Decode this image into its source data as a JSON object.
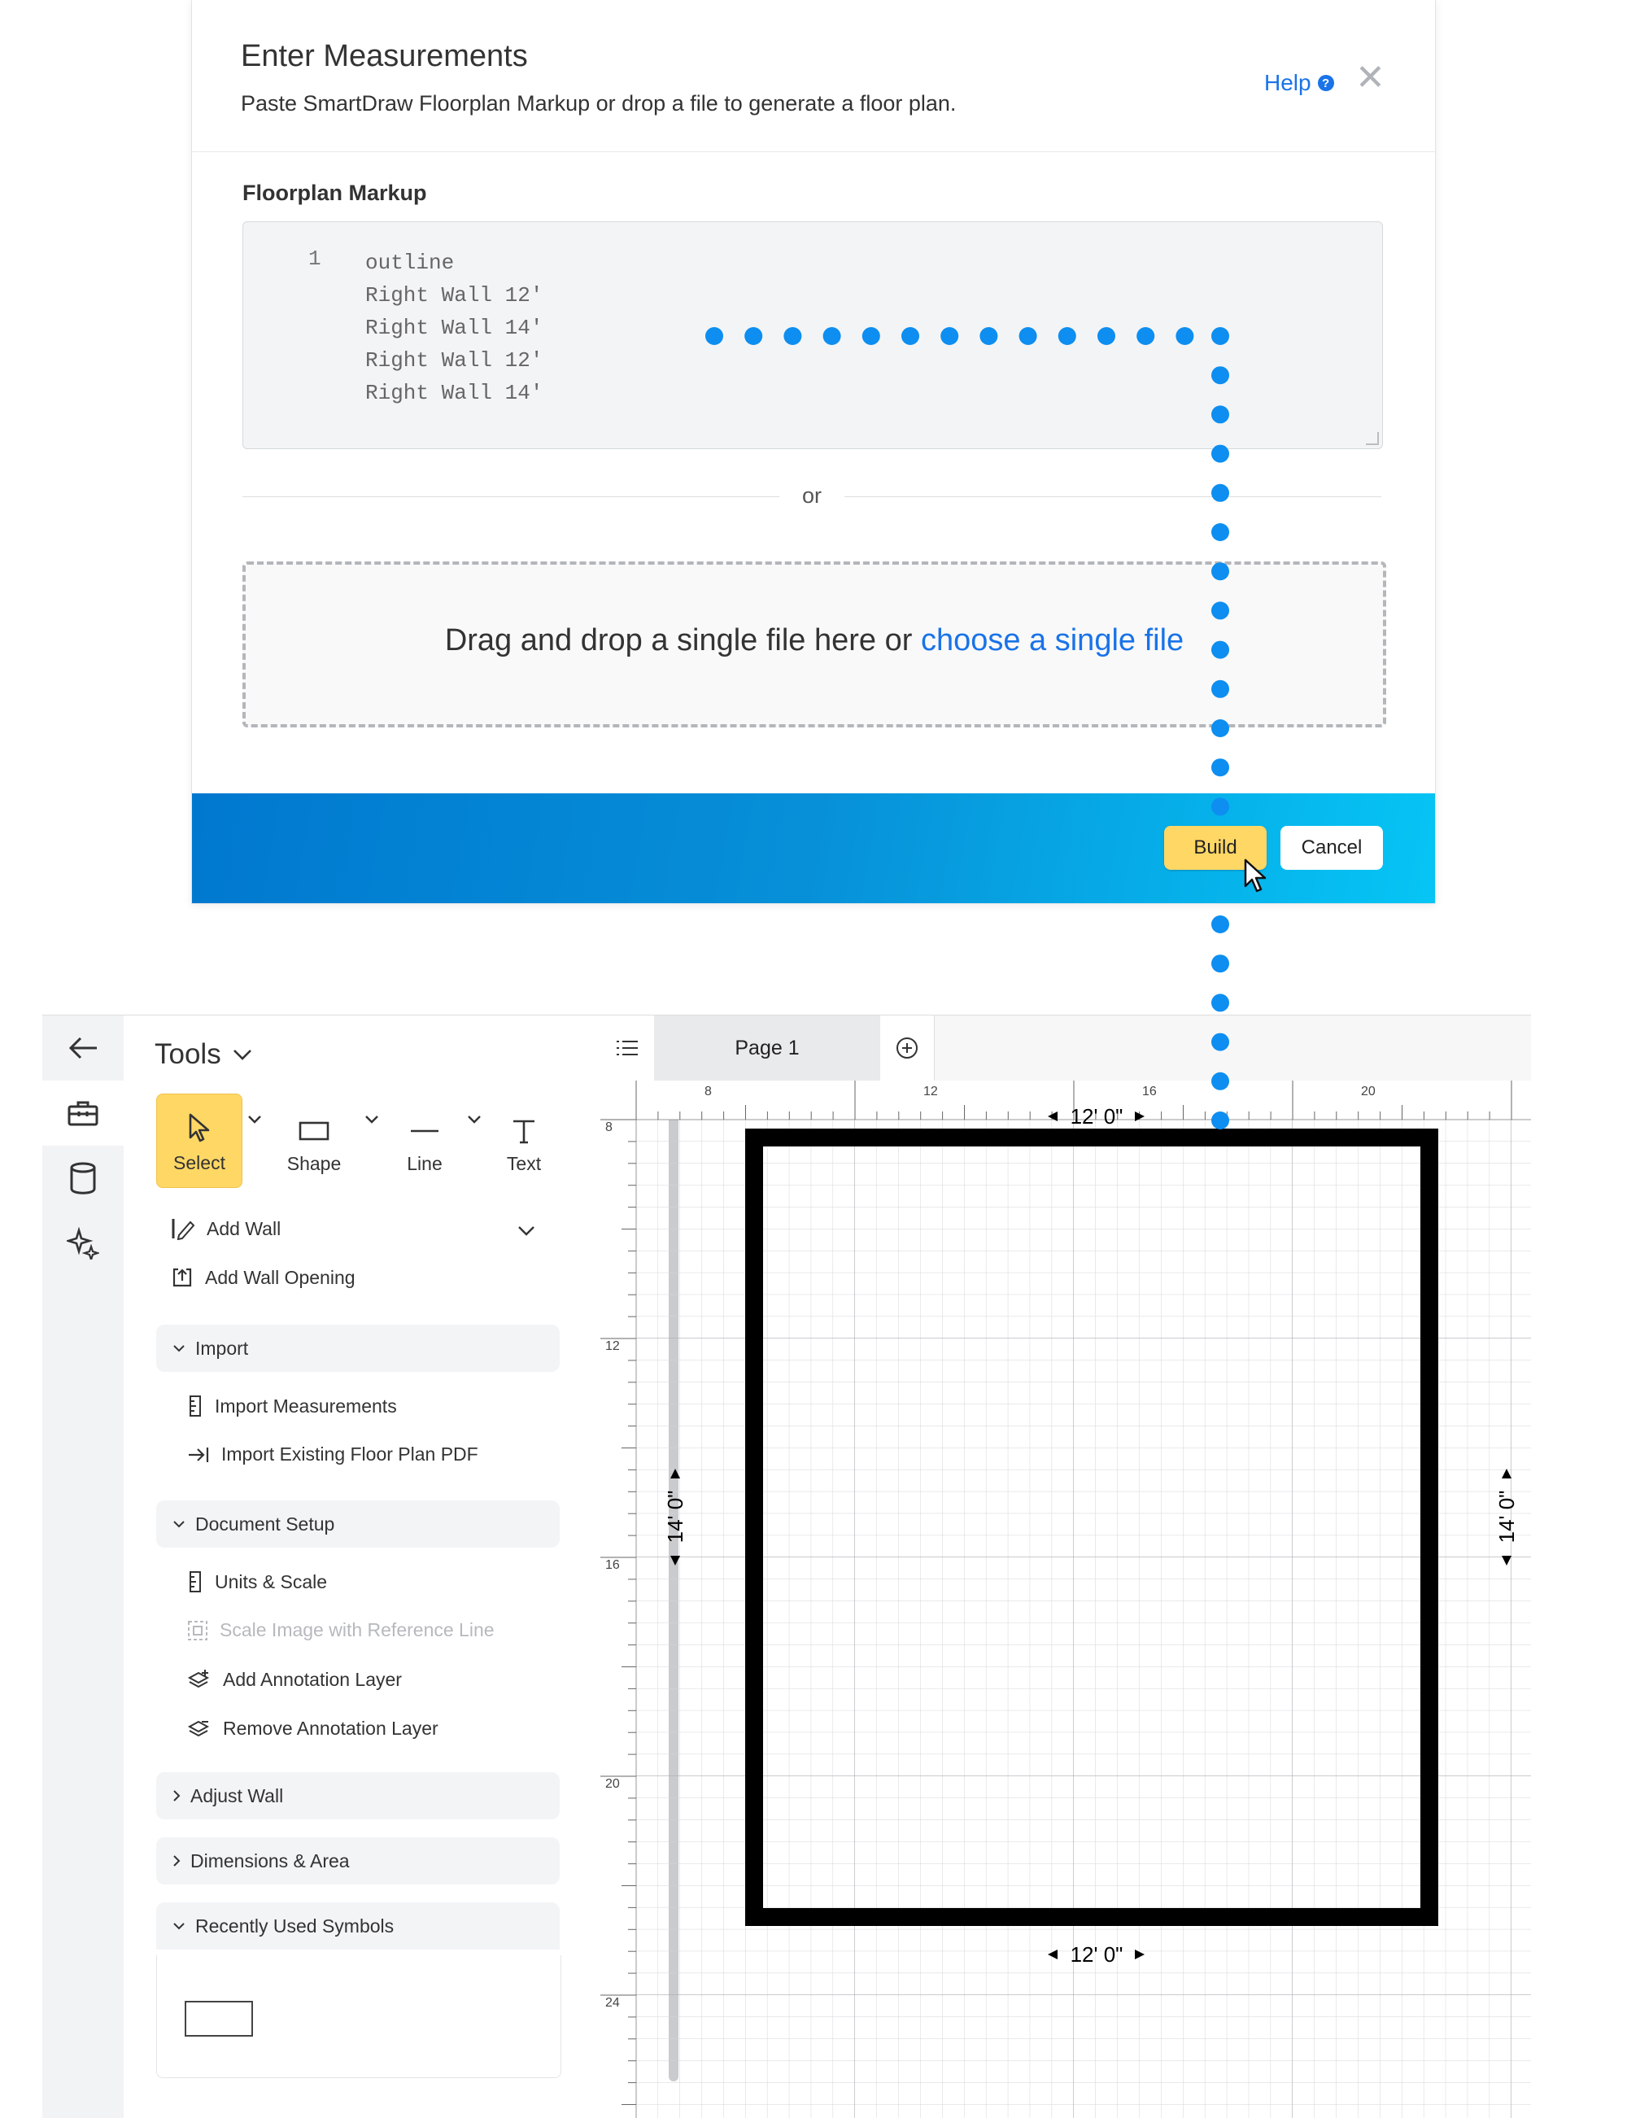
{
  "modal": {
    "title": "Enter Measurements",
    "subtitle": "Paste SmartDraw Floorplan Markup or drop a file to generate a floor plan.",
    "help_label": "Help",
    "markup_label": "Floorplan Markup",
    "code": {
      "line_number": "1",
      "lines": [
        "outline",
        "Right Wall 12'",
        "Right Wall 14'",
        "Right Wall 12'",
        "Right Wall 14'"
      ]
    },
    "or_label": "or",
    "drop_text": "Drag and drop a single file here or ",
    "drop_link": "choose a single file",
    "build_label": "Build",
    "cancel_label": "Cancel"
  },
  "panel": {
    "title": "Tools",
    "tools": [
      {
        "label": "Select",
        "icon": "pointer-icon"
      },
      {
        "label": "Shape",
        "icon": "rectangle-icon"
      },
      {
        "label": "Line",
        "icon": "line-icon"
      },
      {
        "label": "Text",
        "icon": "text-icon"
      }
    ],
    "add_wall": "Add Wall",
    "add_wall_opening": "Add Wall Opening",
    "sections": {
      "import": {
        "label": "Import",
        "items": [
          "Import Measurements",
          "Import Existing Floor Plan PDF"
        ]
      },
      "document_setup": {
        "label": "Document Setup",
        "items": [
          "Units & Scale",
          "Scale Image with Reference Line",
          "Add Annotation Layer",
          "Remove Annotation Layer"
        ]
      },
      "adjust_wall": {
        "label": "Adjust Wall"
      },
      "dimensions_area": {
        "label": "Dimensions & Area"
      },
      "recently_used": {
        "label": "Recently Used Symbols"
      }
    }
  },
  "tabs": {
    "page_label": "Page 1"
  },
  "ruler": {
    "horizontal": [
      "8",
      "12",
      "16",
      "20"
    ],
    "vertical": [
      "8",
      "12",
      "16",
      "20",
      "24"
    ]
  },
  "floorplan": {
    "dimensions": {
      "top": "12' 0\"",
      "bottom": "12' 0\"",
      "left": "14' 0\"",
      "right": "14' 0\""
    }
  },
  "colors": {
    "accent": "#1a73e8",
    "select_yellow": "#ffd765",
    "dotted_path": "#0d8ef0"
  }
}
